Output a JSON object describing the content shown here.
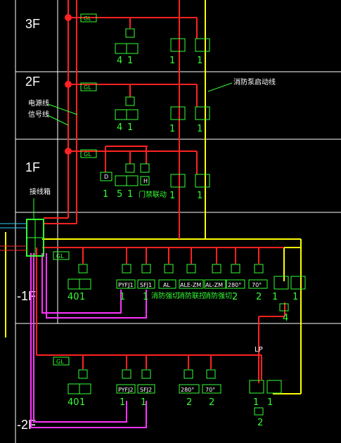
{
  "floors": {
    "f3": "3F",
    "f2": "2F",
    "f1": "1F",
    "b1": "-1F",
    "b2": "-2F"
  },
  "labels": {
    "power_line": "电源线",
    "signal_line": "信号线",
    "fire_pump_line": "消防泵启动线",
    "junction_box": "接线箱"
  },
  "box_text": {
    "gl": "GL",
    "pyfj1": "PYFJ1",
    "sfj1": "SFJ1",
    "al": "AL",
    "alezm": "ALE-ZM",
    "alzm": "AL-ZM",
    "d280": "280°",
    "d70": "70°",
    "pyfj2": "PYFJ2",
    "sfj2": "SFJ2",
    "d": "D",
    "h": "H",
    "lp": "LP"
  },
  "counts": {
    "f3": [
      "4",
      "1",
      "1",
      "1"
    ],
    "f2": [
      "4",
      "1",
      "1",
      "1"
    ],
    "f1": [
      "1",
      "5",
      "1",
      "1",
      "1"
    ],
    "f1_door": "门禁联动",
    "b1": [
      "40",
      "1",
      "1",
      "1",
      "2",
      "2",
      "1",
      "1"
    ],
    "b1_pump": "4",
    "b1_texts": [
      "消防强切",
      "消防联控",
      "消防强切"
    ],
    "b2": [
      "40",
      "1",
      "1",
      "1",
      "2",
      "2",
      "1",
      "1"
    ],
    "b2_pump": "2"
  },
  "colors": {
    "power": "#ff2222",
    "signal": "#ff33ff",
    "pump_line": "#ffff00",
    "device": "#33ff33",
    "text": "#ffffff",
    "frame": "#ffffff",
    "accent": "#33ccff"
  }
}
